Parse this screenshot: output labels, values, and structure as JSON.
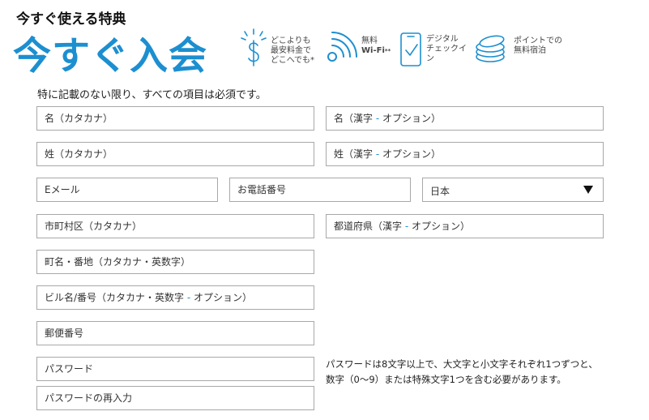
{
  "header": {
    "subtitle": "今すぐ使える特典",
    "title": "今すぐ入会"
  },
  "benefits": [
    {
      "icon": "dollar-icon",
      "line1": "どこよりも",
      "line2": "最安料金で",
      "line3": "どこへでも*"
    },
    {
      "icon": "wifi-icon",
      "line1": "無料",
      "line2": "Wi-Fi",
      "sup": "**"
    },
    {
      "icon": "mobile-checkin-icon",
      "line1": "デジタル",
      "line2": "チェックイ",
      "line3": "ン"
    },
    {
      "icon": "coins-icon",
      "line1": "ポイントでの",
      "line2": "無料宿泊"
    }
  ],
  "form": {
    "required_note": "特に記載のない限り、すべての項目は必須です。",
    "first_name_kana": "名（カタカナ）",
    "first_name_kanji": "名（漢字",
    "last_name_kana": "姓（カタカナ）",
    "last_name_kanji": "姓（漢字",
    "option_sep": " - ",
    "option_word": "オプション",
    "close_paren": "）",
    "email": "Eメール",
    "phone": "お電話番号",
    "country": "日本",
    "city_kana": "市町村区（カタカナ）",
    "prefecture_kanji": "都道府県（漢字",
    "street_kana": "町名・番地（カタカナ・英数字）",
    "building": "ビル名/番号（カタカナ・英数字",
    "postal_code": "郵便番号",
    "password": "パスワード",
    "password_confirm": "パスワードの再入力",
    "password_note": "パスワードは8文字以上で、大文字と小文字それぞれ1つずつと、数字（0～9）または特殊文字1つを含む必要があります。"
  },
  "colors": {
    "accent": "#1c8fd0",
    "border": "#a8a8a8"
  }
}
